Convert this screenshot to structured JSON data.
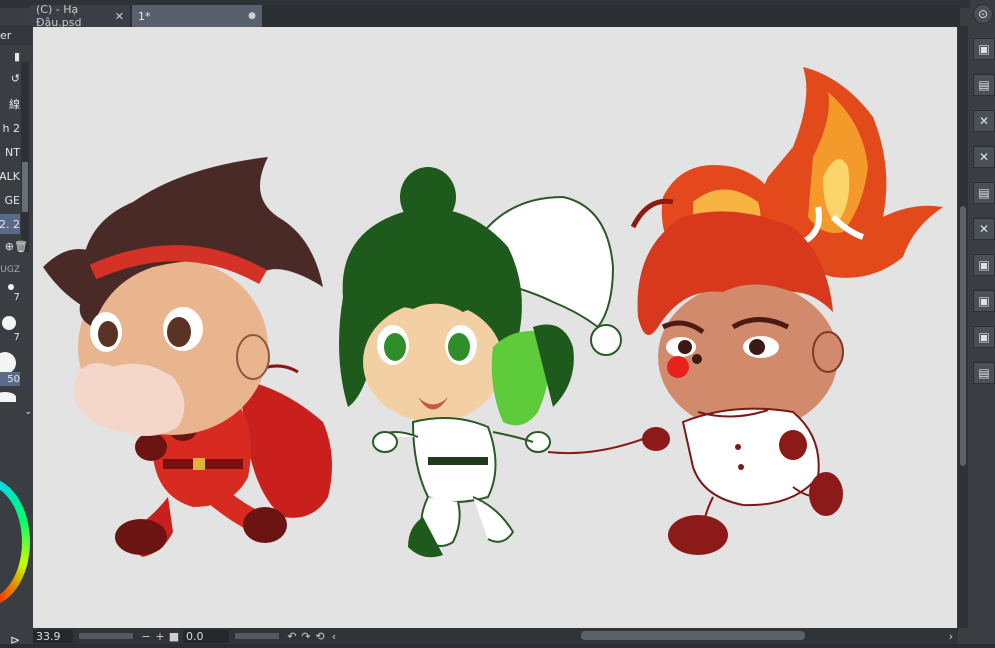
{
  "tabs": [
    {
      "label": "(C) - Hạ Đậu.psd",
      "close": "✕"
    },
    {
      "label": "1*",
      "modified_marker": "●"
    }
  ],
  "left_panel": {
    "header": "er",
    "items": [
      "線",
      "h 2",
      "NT",
      "ALK",
      "GE",
      "2. 2"
    ],
    "brush_sizes": [
      "7",
      "7",
      "50"
    ],
    "section_label": "UGZ"
  },
  "bottom_bar": {
    "zoom": "33.9",
    "minus": "−",
    "plus": "+",
    "rotation": "0.0"
  },
  "icons": {
    "rotate_left": "rotate-left-icon",
    "rotate_right": "rotate-right-icon",
    "reset": "reset-icon",
    "stop": "stop-icon"
  }
}
